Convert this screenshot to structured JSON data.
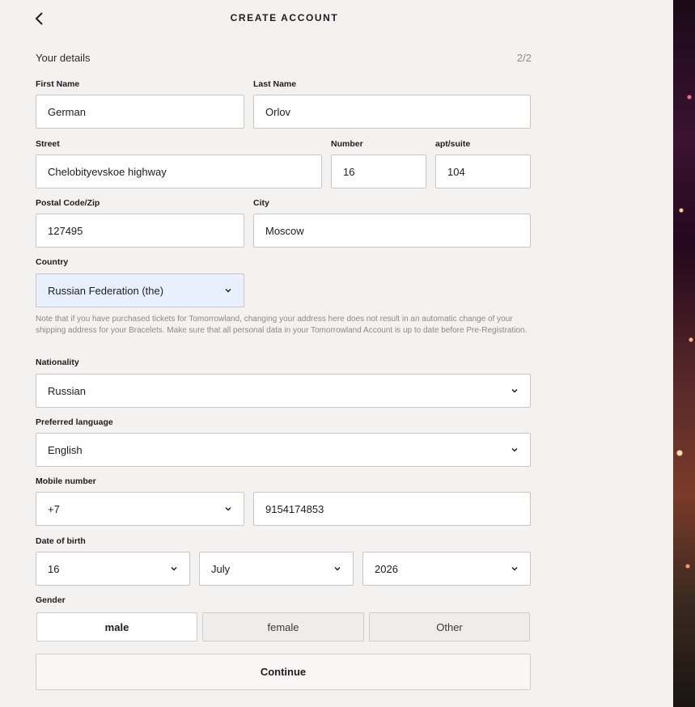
{
  "header": {
    "title": "CREATE ACCOUNT",
    "back_icon": "chevron-left-icon"
  },
  "section": {
    "title": "Your details",
    "step": "2/2"
  },
  "fields": {
    "first_name": {
      "label": "First Name",
      "value": "German"
    },
    "last_name": {
      "label": "Last Name",
      "value": "Orlov"
    },
    "street": {
      "label": "Street",
      "value": "Chelobityevskoe highway"
    },
    "number": {
      "label": "Number",
      "value": "16"
    },
    "apt": {
      "label": "apt/suite",
      "value": "104"
    },
    "postal": {
      "label": "Postal Code/Zip",
      "value": "127495"
    },
    "city": {
      "label": "City",
      "value": "Moscow"
    },
    "country": {
      "label": "Country",
      "value": "Russian Federation (the)"
    },
    "nationality": {
      "label": "Nationality",
      "value": "Russian"
    },
    "language": {
      "label": "Preferred language",
      "value": "English"
    },
    "mobile": {
      "label": "Mobile number",
      "prefix": "+7",
      "value": "9154174853"
    },
    "dob": {
      "label": "Date of birth",
      "day": "16",
      "month": "July",
      "year": "2026"
    }
  },
  "note": "Note that if you have purchased tickets for Tomorrowland, changing your address here does not result in an automatic change of your shipping address for your Bracelets. Make sure that all personal data in your Tomorrowland Account is up to date before Pre-Registration.",
  "gender": {
    "label": "Gender",
    "options": [
      "male",
      "female",
      "Other"
    ],
    "selected": "male"
  },
  "continue_label": "Continue",
  "colors": {
    "background": "#f4f2f0",
    "highlight": "#e8effd",
    "border": "#c9c6c3"
  }
}
